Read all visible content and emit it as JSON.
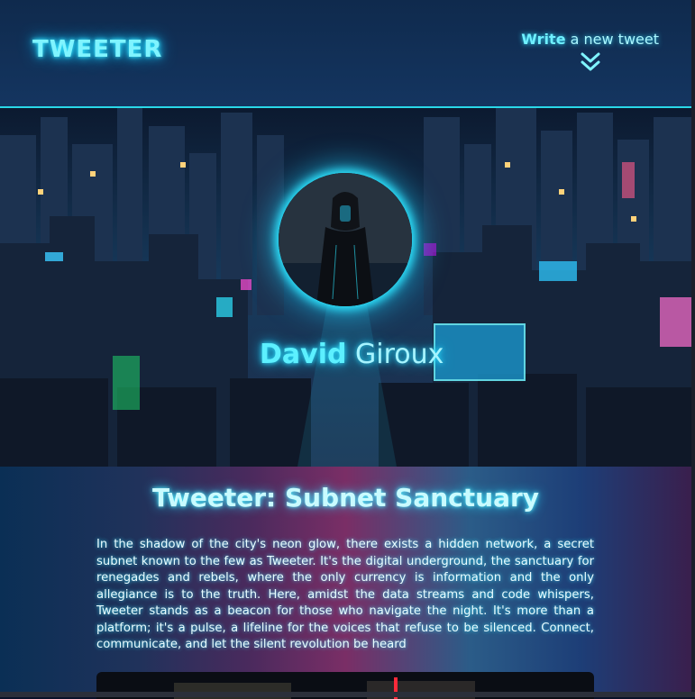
{
  "header": {
    "logo": "TWEETER",
    "write_bold": "Write",
    "write_rest": " a new tweet"
  },
  "hero": {
    "name_first": "David",
    "name_last": " Giroux"
  },
  "main": {
    "title": "Tweeter: Subnet Sanctuary",
    "paragraph": "In the shadow of the city's neon glow, there exists a hidden network, a secret subnet known to the few as Tweeter. It's the digital underground, the sanctuary for renegades and rebels, where the only currency is information and the only allegiance is to the truth. Here, amidst the data streams and code whispers, Tweeter stands as a beacon for those who navigate the night. It's more than a platform; it's a pulse, a lifeline for the voices that refuse to be silenced. Connect, communicate, and let the silent revolution be heard"
  },
  "icons": {
    "chevron": "chevron-double-down-icon"
  },
  "colors": {
    "accent": "#2ee6ff",
    "header_bg": "#143560"
  }
}
